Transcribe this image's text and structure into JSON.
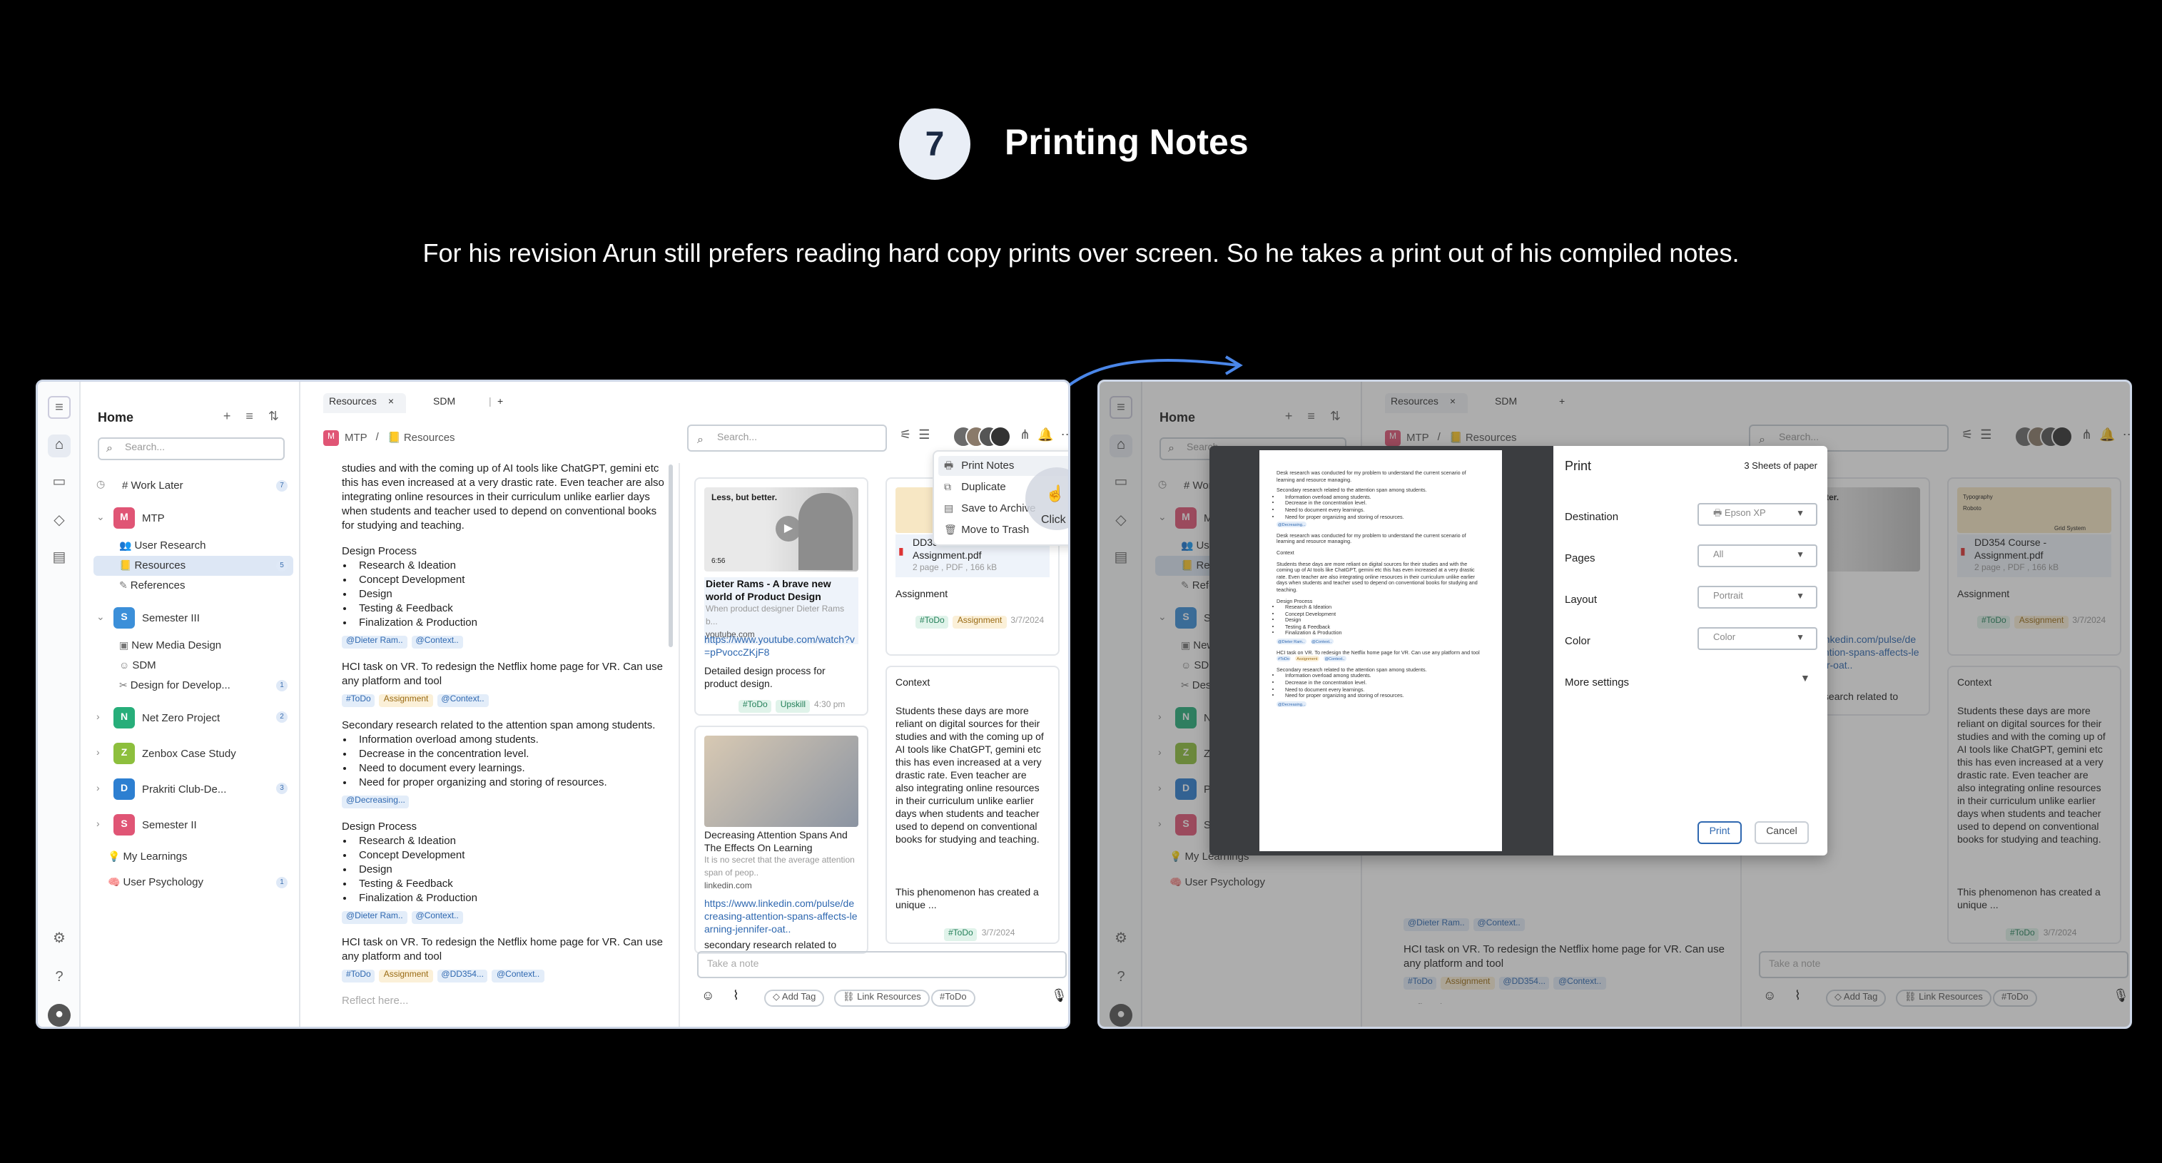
{
  "step": {
    "number": "7",
    "title": "Printing Notes",
    "description": "For his revision Arun still prefers reading hard copy prints over screen. So he takes a print out of his compiled notes."
  },
  "sidebar": {
    "home": "Home",
    "search_placeholder": "Search...",
    "work_later": "# Work Later",
    "work_later_count": "7",
    "groups": [
      {
        "letter": "M",
        "label": "MTP",
        "color": "#e05575",
        "children": [
          {
            "label": "User Research"
          },
          {
            "label": "Resources",
            "count": "5"
          },
          {
            "label": "References"
          }
        ]
      },
      {
        "letter": "S",
        "label": "Semester III",
        "color": "#3b8fd9",
        "children": [
          {
            "label": "New Media Design"
          },
          {
            "label": "SDM"
          },
          {
            "label": "Design for Develop...",
            "count": "1"
          }
        ]
      }
    ],
    "others": [
      {
        "letter": "N",
        "label": "Net Zero Project",
        "color": "#27ae7a",
        "count": "2"
      },
      {
        "letter": "Z",
        "label": "Zenbox Case Study",
        "color": "#8dbf3d"
      },
      {
        "letter": "D",
        "label": "Prakriti Club-De...",
        "color": "#2d7fd1",
        "count": "3"
      },
      {
        "letter": "S",
        "label": "Semester II",
        "color": "#e05575"
      }
    ],
    "my_learnings": "My Learnings",
    "user_psychology": "User Psychology",
    "user_psychology_count": "1"
  },
  "tabs": [
    {
      "label": "Resources"
    },
    {
      "label": "SDM"
    }
  ],
  "breadcrumb": {
    "root": "MTP",
    "sep": "/",
    "current": "Resources"
  },
  "search": {
    "placeholder": "Search..."
  },
  "notes": {
    "p1": "studies and with the coming up of AI tools like ChatGPT, gemini etc this has even increased at a very drastic rate. Even teacher are also integrating online resources in their curriculum unlike earlier days when students and teacher used to depend on conventional books for studying and teaching.",
    "design_process": "Design Process",
    "dp_items": [
      "Research & Ideation",
      "Concept Development",
      "Design",
      "Testing & Feedback",
      "Finalization & Production"
    ],
    "tag_dieter": "@Dieter Ram..",
    "tag_context": "@Context..",
    "hci": "HCI task on VR. To redesign the Netflix home page for VR. Can use any platform and tool",
    "tag_todo": "#ToDo",
    "tag_assignment": "Assignment",
    "secondary": "Secondary research related to the attention span among students.",
    "sec_items": [
      "Information overload among students.",
      "Decrease in the concentration level.",
      "Need to document every learnings.",
      "Need for proper organizing and storing of resources."
    ],
    "tag_decreasing": "@Decreasing...",
    "tag_dd354": "@DD354...",
    "reflect": "Reflect here..."
  },
  "cards": {
    "video": {
      "overlay": "Less, but better.",
      "duration": "6:56",
      "title": "Dieter Rams - A brave new world of Product Design",
      "desc": "When product designer Dieter Rams b...",
      "site": "youtube.com",
      "url": "https://www.youtube.com/watch?v=pPvoccZKjF8",
      "note": "Detailed design process for product design.",
      "tag_todo": "#ToDo",
      "tag_upskill": "Upskill",
      "time": "4:30 pm"
    },
    "pdf": {
      "typography": "Typography",
      "roboto": "Roboto",
      "grid": "Grid System",
      "title": "DD354 Course - Assignment.pdf",
      "meta": "2 page , PDF , 166 kB",
      "label": "Assignment",
      "tag_todo": "#ToDo",
      "tag_assignment": "Assignment",
      "date": "3/7/2024"
    },
    "article": {
      "title": "Decreasing Attention Spans And The Effects On Learning",
      "desc": "It is no secret that the average attention span of peop..",
      "site": "linkedin.com",
      "url": "https://www.linkedin.com/pulse/decreasing-attention-spans-affects-learning-jennifer-oat..",
      "note": "secondary research related to"
    },
    "context": {
      "title": "Context",
      "body": "Students these days are more reliant on digital sources for their studies and with the coming up of AI tools like ChatGPT, gemini etc this has even increased at a very drastic rate. Even teacher are also integrating online resources in their curriculum unlike earlier days when students and teacher used to depend on conventional books for studying and teaching.",
      "body2": "This phenomenon has created a unique ...",
      "tag_todo": "#ToDo",
      "date": "3/7/2024"
    }
  },
  "note_input": {
    "placeholder": "Take a note"
  },
  "bottom": {
    "add_tag": "Add Tag",
    "link_resources": "Link Resources",
    "todo": "#ToDo"
  },
  "menu": {
    "print_notes": "Print Notes",
    "duplicate": "Duplicate",
    "save_archive": "Save to Archive",
    "trash": "Move to Trash",
    "click": "Click"
  },
  "print": {
    "title": "Print",
    "sheets": "3 Sheets of paper",
    "destination_label": "Destination",
    "destination": "Epson XP",
    "pages_label": "Pages",
    "pages": "All",
    "layout_label": "Layout",
    "layout": "Portrait",
    "color_label": "Color",
    "color": "Color",
    "more": "More settings",
    "print_btn": "Print",
    "cancel_btn": "Cancel",
    "preview": {
      "p1": "Desk research was conducted for my problem to understand the current scenario of learning and resource managing.",
      "p2": "Secondary research related to the attention span among students.",
      "items": [
        "Information overload among students.",
        "Decrease in the concentration level.",
        "Need to document every learnings.",
        "Need for proper organizing and storing of resources."
      ],
      "tag_decreasing": "@Decreasing...",
      "p3": "Desk research was conducted for my problem to understand the current scenario of learning and resource managing.",
      "context": "Context",
      "p4": "Students these days are more reliant on digital sources for their studies and with the coming up of AI tools like ChatGPT, gemini etc this has even increased at a very drastic rate. Even teacher are also integrating online resources in their curriculum unlike earlier days when students and teacher used to depend on conventional books for studying and teaching.",
      "dp": "Design Process",
      "dp_items": [
        "Research & Ideation",
        "Concept Development",
        "Design",
        "Testing & Feedback",
        "Finalization & Production"
      ],
      "tag_dieter": "@Dieter Ram..",
      "tag_context": "@Context..",
      "hci": "HCI task on VR. To redesign the Netflix home page for VR. Can use any platform and tool",
      "tag_todo": "#ToDo",
      "tag_assignment": "Assignment",
      "p5": "Secondary research related to the attention span among students.",
      "items2": [
        "Information overload among students.",
        "Decrease in the concentration level.",
        "Need to document every learnings.",
        "Need for proper organizing and storing of resources."
      ]
    }
  },
  "colors": {
    "accent": "#2f68b0",
    "panel_border": "#cdd6e6",
    "background": "#000000"
  }
}
